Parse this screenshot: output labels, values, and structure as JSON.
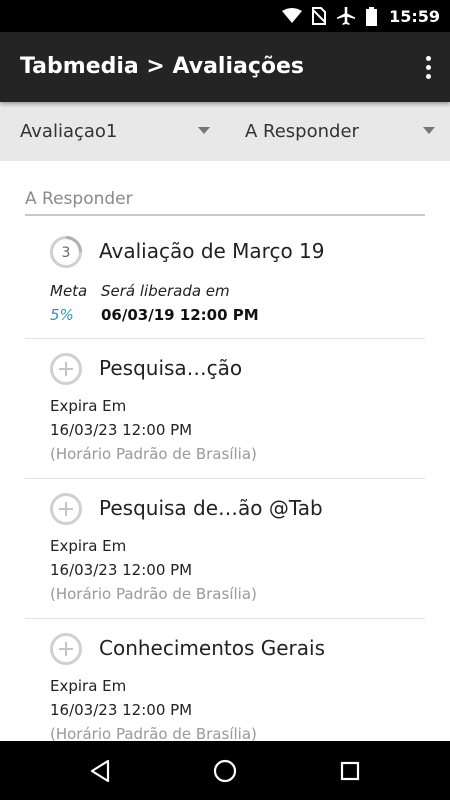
{
  "status_bar": {
    "time": "15:59",
    "icons": [
      "wifi-icon",
      "no-sim-icon",
      "airplane-mode-icon",
      "battery-icon"
    ]
  },
  "app_bar": {
    "title": "Tabmedia > Avaliações",
    "overflow_icon": "more-vert-icon"
  },
  "filters": {
    "evaluation_select": {
      "selected": "Avaliaçao1"
    },
    "status_select": {
      "selected": "A Responder"
    }
  },
  "section": {
    "header": "A Responder"
  },
  "cards": [
    {
      "icon_badge": "3",
      "title": "Avaliação de Março 19",
      "meta_label": "Meta",
      "meta_value": "5%",
      "release_label": "Será liberada em",
      "release_date": "06/03/19 12:00 PM"
    },
    {
      "icon": "add-circle-icon",
      "title": "Pesquisa…ção",
      "expire_label": "Expira Em",
      "expire_date": "16/03/23 12:00 PM",
      "timezone": "(Horário Padrão de Brasília)"
    },
    {
      "icon": "add-circle-icon",
      "title": "Pesquisa de…ão @Tab",
      "expire_label": "Expira Em",
      "expire_date": "16/03/23 12:00 PM",
      "timezone": "(Horário Padrão de Brasília)"
    },
    {
      "icon": "add-circle-icon",
      "title": "Conhecimentos Gerais",
      "expire_label": "Expira Em",
      "expire_date": "16/03/23 12:00 PM",
      "timezone": "(Horário Padrão de Brasília)"
    }
  ],
  "colors": {
    "app_bar": "#242424",
    "filter_bar": "#e8e8e8",
    "accent_meta": "#2a9ab0",
    "muted_text": "#999999"
  },
  "nav_bar": {
    "icons": [
      "back-icon",
      "home-icon",
      "recents-icon"
    ]
  }
}
